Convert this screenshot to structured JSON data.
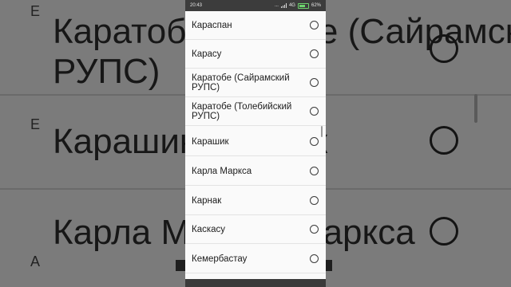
{
  "status_bar": {
    "time": "20:43",
    "dots": "...",
    "network": "4G",
    "battery": "62%"
  },
  "list": {
    "items": [
      {
        "label": "Караспан"
      },
      {
        "label": "Карасу"
      },
      {
        "label": "Каратобе (Сайрамский РУПС)"
      },
      {
        "label": "Каратобе (Толебийский РУПС)"
      },
      {
        "label": "Карашик"
      },
      {
        "label": "Карла Маркса"
      },
      {
        "label": "Карнак"
      },
      {
        "label": "Каскасу"
      },
      {
        "label": "Кемербастау"
      }
    ]
  },
  "background": {
    "row1": "Каратобе (Сайрамский",
    "row1b": "РУПС)",
    "row2": "Карашик",
    "row3": "Карла Маркса",
    "letter_b1": "Е",
    "letter_b2": "Е",
    "letter_a": "А"
  }
}
